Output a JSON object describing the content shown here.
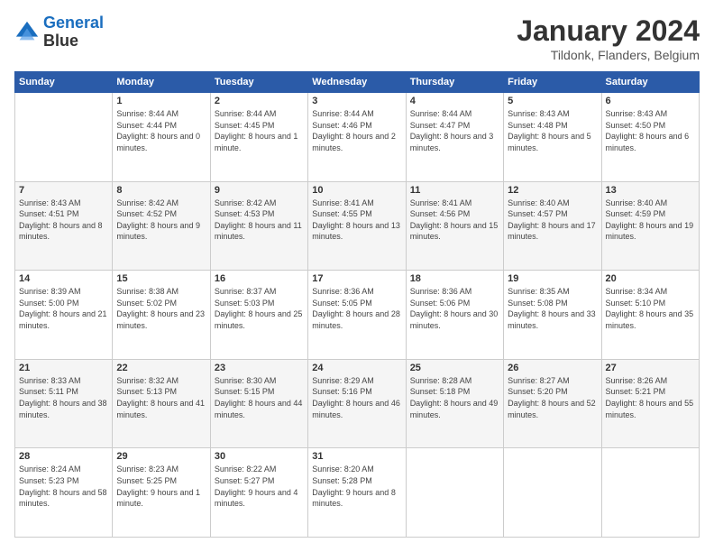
{
  "header": {
    "logo_line1": "General",
    "logo_line2": "Blue",
    "month_title": "January 2024",
    "location": "Tildonk, Flanders, Belgium"
  },
  "weekdays": [
    "Sunday",
    "Monday",
    "Tuesday",
    "Wednesday",
    "Thursday",
    "Friday",
    "Saturday"
  ],
  "weeks": [
    [
      {
        "day": "",
        "sunrise": "",
        "sunset": "",
        "daylight": ""
      },
      {
        "day": "1",
        "sunrise": "Sunrise: 8:44 AM",
        "sunset": "Sunset: 4:44 PM",
        "daylight": "Daylight: 8 hours and 0 minutes."
      },
      {
        "day": "2",
        "sunrise": "Sunrise: 8:44 AM",
        "sunset": "Sunset: 4:45 PM",
        "daylight": "Daylight: 8 hours and 1 minute."
      },
      {
        "day": "3",
        "sunrise": "Sunrise: 8:44 AM",
        "sunset": "Sunset: 4:46 PM",
        "daylight": "Daylight: 8 hours and 2 minutes."
      },
      {
        "day": "4",
        "sunrise": "Sunrise: 8:44 AM",
        "sunset": "Sunset: 4:47 PM",
        "daylight": "Daylight: 8 hours and 3 minutes."
      },
      {
        "day": "5",
        "sunrise": "Sunrise: 8:43 AM",
        "sunset": "Sunset: 4:48 PM",
        "daylight": "Daylight: 8 hours and 5 minutes."
      },
      {
        "day": "6",
        "sunrise": "Sunrise: 8:43 AM",
        "sunset": "Sunset: 4:50 PM",
        "daylight": "Daylight: 8 hours and 6 minutes."
      }
    ],
    [
      {
        "day": "7",
        "sunrise": "Sunrise: 8:43 AM",
        "sunset": "Sunset: 4:51 PM",
        "daylight": "Daylight: 8 hours and 8 minutes."
      },
      {
        "day": "8",
        "sunrise": "Sunrise: 8:42 AM",
        "sunset": "Sunset: 4:52 PM",
        "daylight": "Daylight: 8 hours and 9 minutes."
      },
      {
        "day": "9",
        "sunrise": "Sunrise: 8:42 AM",
        "sunset": "Sunset: 4:53 PM",
        "daylight": "Daylight: 8 hours and 11 minutes."
      },
      {
        "day": "10",
        "sunrise": "Sunrise: 8:41 AM",
        "sunset": "Sunset: 4:55 PM",
        "daylight": "Daylight: 8 hours and 13 minutes."
      },
      {
        "day": "11",
        "sunrise": "Sunrise: 8:41 AM",
        "sunset": "Sunset: 4:56 PM",
        "daylight": "Daylight: 8 hours and 15 minutes."
      },
      {
        "day": "12",
        "sunrise": "Sunrise: 8:40 AM",
        "sunset": "Sunset: 4:57 PM",
        "daylight": "Daylight: 8 hours and 17 minutes."
      },
      {
        "day": "13",
        "sunrise": "Sunrise: 8:40 AM",
        "sunset": "Sunset: 4:59 PM",
        "daylight": "Daylight: 8 hours and 19 minutes."
      }
    ],
    [
      {
        "day": "14",
        "sunrise": "Sunrise: 8:39 AM",
        "sunset": "Sunset: 5:00 PM",
        "daylight": "Daylight: 8 hours and 21 minutes."
      },
      {
        "day": "15",
        "sunrise": "Sunrise: 8:38 AM",
        "sunset": "Sunset: 5:02 PM",
        "daylight": "Daylight: 8 hours and 23 minutes."
      },
      {
        "day": "16",
        "sunrise": "Sunrise: 8:37 AM",
        "sunset": "Sunset: 5:03 PM",
        "daylight": "Daylight: 8 hours and 25 minutes."
      },
      {
        "day": "17",
        "sunrise": "Sunrise: 8:36 AM",
        "sunset": "Sunset: 5:05 PM",
        "daylight": "Daylight: 8 hours and 28 minutes."
      },
      {
        "day": "18",
        "sunrise": "Sunrise: 8:36 AM",
        "sunset": "Sunset: 5:06 PM",
        "daylight": "Daylight: 8 hours and 30 minutes."
      },
      {
        "day": "19",
        "sunrise": "Sunrise: 8:35 AM",
        "sunset": "Sunset: 5:08 PM",
        "daylight": "Daylight: 8 hours and 33 minutes."
      },
      {
        "day": "20",
        "sunrise": "Sunrise: 8:34 AM",
        "sunset": "Sunset: 5:10 PM",
        "daylight": "Daylight: 8 hours and 35 minutes."
      }
    ],
    [
      {
        "day": "21",
        "sunrise": "Sunrise: 8:33 AM",
        "sunset": "Sunset: 5:11 PM",
        "daylight": "Daylight: 8 hours and 38 minutes."
      },
      {
        "day": "22",
        "sunrise": "Sunrise: 8:32 AM",
        "sunset": "Sunset: 5:13 PM",
        "daylight": "Daylight: 8 hours and 41 minutes."
      },
      {
        "day": "23",
        "sunrise": "Sunrise: 8:30 AM",
        "sunset": "Sunset: 5:15 PM",
        "daylight": "Daylight: 8 hours and 44 minutes."
      },
      {
        "day": "24",
        "sunrise": "Sunrise: 8:29 AM",
        "sunset": "Sunset: 5:16 PM",
        "daylight": "Daylight: 8 hours and 46 minutes."
      },
      {
        "day": "25",
        "sunrise": "Sunrise: 8:28 AM",
        "sunset": "Sunset: 5:18 PM",
        "daylight": "Daylight: 8 hours and 49 minutes."
      },
      {
        "day": "26",
        "sunrise": "Sunrise: 8:27 AM",
        "sunset": "Sunset: 5:20 PM",
        "daylight": "Daylight: 8 hours and 52 minutes."
      },
      {
        "day": "27",
        "sunrise": "Sunrise: 8:26 AM",
        "sunset": "Sunset: 5:21 PM",
        "daylight": "Daylight: 8 hours and 55 minutes."
      }
    ],
    [
      {
        "day": "28",
        "sunrise": "Sunrise: 8:24 AM",
        "sunset": "Sunset: 5:23 PM",
        "daylight": "Daylight: 8 hours and 58 minutes."
      },
      {
        "day": "29",
        "sunrise": "Sunrise: 8:23 AM",
        "sunset": "Sunset: 5:25 PM",
        "daylight": "Daylight: 9 hours and 1 minute."
      },
      {
        "day": "30",
        "sunrise": "Sunrise: 8:22 AM",
        "sunset": "Sunset: 5:27 PM",
        "daylight": "Daylight: 9 hours and 4 minutes."
      },
      {
        "day": "31",
        "sunrise": "Sunrise: 8:20 AM",
        "sunset": "Sunset: 5:28 PM",
        "daylight": "Daylight: 9 hours and 8 minutes."
      },
      {
        "day": "",
        "sunrise": "",
        "sunset": "",
        "daylight": ""
      },
      {
        "day": "",
        "sunrise": "",
        "sunset": "",
        "daylight": ""
      },
      {
        "day": "",
        "sunrise": "",
        "sunset": "",
        "daylight": ""
      }
    ]
  ]
}
